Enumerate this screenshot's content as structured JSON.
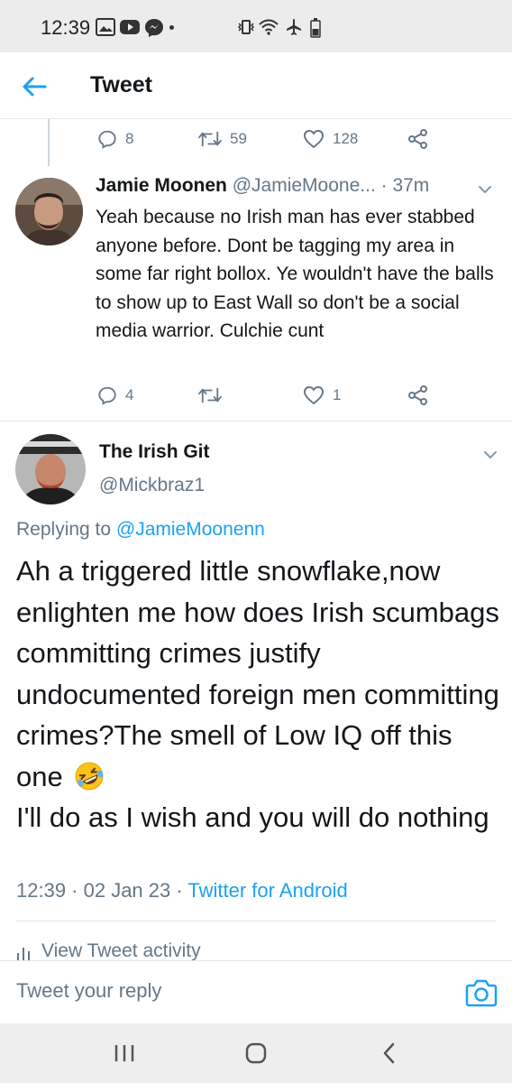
{
  "status_bar": {
    "time": "12:39"
  },
  "header": {
    "title": "Tweet"
  },
  "parent_actions": {
    "replies": "8",
    "retweets": "59",
    "likes": "128"
  },
  "reply": {
    "name": "Jamie Moonen",
    "handle": "@JamieMoone...",
    "time": "· 37m",
    "text": "Yeah because no Irish man has ever stabbed anyone before. Dont be tagging my area in some far right bollox. Ye wouldn't have the balls to show up to East Wall so don't be a social media warrior. Culchie cunt",
    "replies": "4",
    "retweets": "",
    "likes": "1"
  },
  "main_tweet": {
    "name": "The Irish Git",
    "handle": "@Mickbraz1",
    "replying_prefix": "Replying to",
    "replying_to": "@JamieMoonenn",
    "text_part1": "Ah a triggered little snowflake,now enlighten me how does Irish scumbags committing crimes justify undocumented foreign men committing crimes?The smell of Low IQ off this one",
    "text_part2": "I'll do as I wish and you will do nothing",
    "timestamp": "12:39 · 02 Jan 23 ·",
    "source": "Twitter for Android",
    "activity_label": "View Tweet activity"
  },
  "composer": {
    "placeholder": "Tweet your reply"
  },
  "colors": {
    "accent": "#1da1f2",
    "secondary_text": "#657786",
    "divider": "#e1e8ed"
  },
  "icons": [
    "back-arrow-icon",
    "reply-icon",
    "retweet-icon",
    "like-icon",
    "share-icon",
    "chevron-down-icon",
    "activity-chart-icon",
    "camera-icon",
    "rofl-emoji"
  ]
}
